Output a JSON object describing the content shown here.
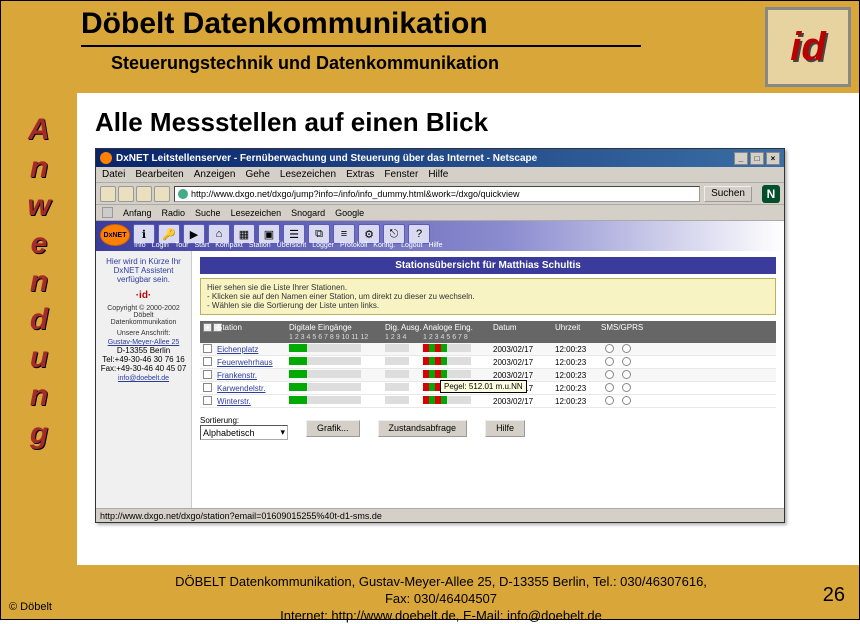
{
  "header": {
    "title": "Döbelt Datenkommunikation",
    "subtitle": "Steuerungstechnik und Datenkommunikation",
    "logo_text": "id"
  },
  "sidebar": {
    "letters": [
      "A",
      "n",
      "w",
      "e",
      "n",
      "d",
      "u",
      "n",
      "g"
    ]
  },
  "content": {
    "title": "Alle Messstellen auf einen Blick"
  },
  "browser": {
    "window_title": "DxNET Leitstellenserver - Fernüberwachung und Steuerung über das Internet - Netscape",
    "menu": [
      "Datei",
      "Bearbeiten",
      "Anzeigen",
      "Gehe",
      "Lesezeichen",
      "Extras",
      "Fenster",
      "Hilfe"
    ],
    "url": "http://www.dxgo.net/dxgo/jump?info=/info/info_dummy.html&work=/dxgo/quickview",
    "search_btn": "Suchen",
    "linkbar": [
      "Anfang",
      "Radio",
      "Suche",
      "Lesezeichen",
      "Snogard",
      "Google"
    ],
    "status": "http://www.dxgo.net/dxgo/station?email=01609015255%40t-d1-sms.de",
    "ns_logo": "N"
  },
  "app": {
    "logo": "DxNET",
    "menu_labels": [
      "Info",
      "Login",
      "Tour",
      "Start",
      "Kompakt",
      "Station",
      "Übersicht",
      "Logger",
      "Protokoll",
      "Konfig.",
      "Logout",
      "Hilfe"
    ],
    "side": {
      "assist": "Hier wird in Kürze Ihr DxNET Assistent verfügbar sein.",
      "id_logo": "·id·",
      "copyright": "Copyright © 2000-2002 Döbelt Datenkommunikation",
      "anschrift_h": "Unsere Anschrift:",
      "addr1": "Gustav-Meyer-Allee 25",
      "addr2": "D-13355 Berlin",
      "tel": "Tel:+49-30-46 30 76 16",
      "fax": "Fax:+49-30-46 40 45 07",
      "email": "info@doebelt.de"
    },
    "panel_title": "Stationsübersicht für Matthias Schultis",
    "info_lines": [
      "Hier sehen sie die Liste Ihrer Stationen.",
      "- Klicken sie auf den Namen einer Station, um direkt zu dieser zu wechseln.",
      "- Wählen sie die Sortierung der Liste unten links."
    ],
    "columns": {
      "station": "Station",
      "de": "Digitale Eingänge",
      "da": "Dig. Ausg.",
      "ae": "Analoge Eing.",
      "datum": "Datum",
      "uhrzeit": "Uhrzeit",
      "sms": "SMS/GPRS"
    },
    "sub": {
      "de": "1 2 3 4 5 6 7 8 9 10 11 12",
      "da": "1 2 3 4",
      "ae": "1 2 3 4 5 6 7 8"
    },
    "rows": [
      {
        "name": "Eichenplatz",
        "date": "2003/02/17",
        "time": "12:00:23"
      },
      {
        "name": "Feuerwehrhaus",
        "date": "2003/02/17",
        "time": "12:00:23"
      },
      {
        "name": "Frankenstr.",
        "date": "2003/02/17",
        "time": "12:00:23"
      },
      {
        "name": "Karwendelstr.",
        "date": "2003/02/17",
        "time": "12:00:23",
        "tooltip": "Pegel: 512.01 m.u.NN"
      },
      {
        "name": "Winterstr.",
        "date": "2003/02/17",
        "time": "12:00:23"
      }
    ],
    "sort_label": "Sortierung:",
    "sort_value": "Alphabetisch",
    "buttons": {
      "grafik": "Grafik...",
      "zustand": "Zustandsabfrage",
      "hilfe": "Hilfe"
    }
  },
  "footer": {
    "line1": "DÖBELT Datenkommunikation, Gustav-Meyer-Allee 25, D-13355 Berlin, Tel.: 030/46307616, Fax: 030/46404507",
    "line2": "Internet: http://www.doebelt.de, E-Mail: info@doebelt.de",
    "page": "26",
    "copyright": "© Döbelt"
  }
}
